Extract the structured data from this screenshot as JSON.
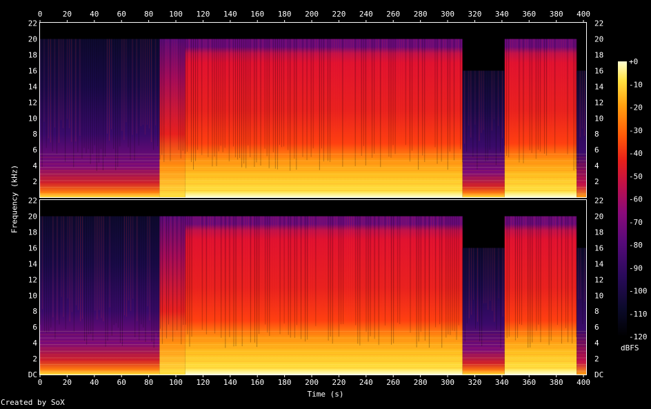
{
  "chart_data": {
    "type": "heatmap",
    "xlabel": "Time (s)",
    "ylabel": "Frequency (kHz)",
    "credit": "Created by SoX",
    "colorbar_label": "dBFS",
    "x_range": [
      0,
      402
    ],
    "y_range_khz": [
      0,
      22.05
    ],
    "x_ticks": [
      0,
      20,
      40,
      60,
      80,
      100,
      120,
      140,
      160,
      180,
      200,
      220,
      240,
      260,
      280,
      300,
      320,
      340,
      360,
      380,
      400
    ],
    "y_tick_labels_top": [
      "22",
      "20",
      "18",
      "16",
      "14",
      "12",
      "10",
      "8",
      "6",
      "4",
      "2"
    ],
    "y_tick_labels_bottom": [
      "22",
      "20",
      "18",
      "16",
      "14",
      "12",
      "10",
      "8",
      "6",
      "4",
      "2",
      "DC"
    ],
    "colorbar_ticks": [
      "+0",
      "-10",
      "-20",
      "-30",
      "-40",
      "-50",
      "-60",
      "-70",
      "-80",
      "-90",
      "-100",
      "-110",
      "-120"
    ],
    "colorbar_range_db": [
      -120,
      0
    ],
    "channels": 2,
    "segments": [
      {
        "start": 0,
        "end": 88,
        "cutoff_khz": 20,
        "level": "quiet"
      },
      {
        "start": 88,
        "end": 107,
        "cutoff_khz": 20,
        "level": "transition"
      },
      {
        "start": 107,
        "end": 311,
        "cutoff_khz": 20,
        "level": "loud"
      },
      {
        "start": 311,
        "end": 342,
        "cutoff_khz": 16,
        "level": "quiet"
      },
      {
        "start": 342,
        "end": 395,
        "cutoff_khz": 20,
        "level": "loud"
      },
      {
        "start": 395,
        "end": 402,
        "cutoff_khz": 16,
        "level": "fade"
      }
    ],
    "colors": {
      "background": "#000000",
      "palette": [
        "#000000",
        "#0b0a2a",
        "#2a0a5a",
        "#560a7a",
        "#8a0a7a",
        "#c0104a",
        "#e8201a",
        "#ff5a08",
        "#ffa010",
        "#ffe040",
        "#ffffd0"
      ]
    }
  }
}
